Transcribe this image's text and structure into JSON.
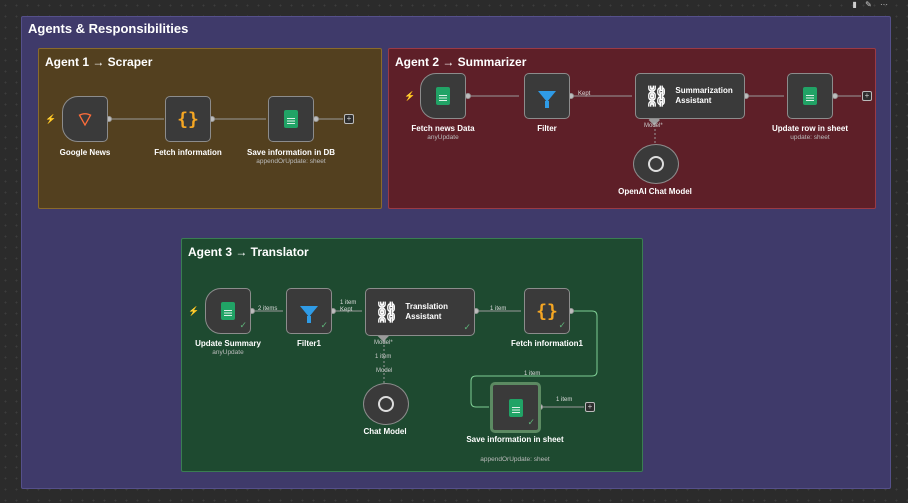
{
  "top_icons": [
    "trash-icon",
    "edit-icon",
    "more-icon"
  ],
  "outer": {
    "title": "Agents & Responsibilities"
  },
  "agent1": {
    "title": "Agent 1 → Scraper",
    "nodes": [
      {
        "label": "Google News",
        "icon": "rss-icon"
      },
      {
        "label": "Fetch information",
        "icon": "braces-icon"
      },
      {
        "label": "Save information in DB",
        "sub": "appendOrUpdate: sheet",
        "icon": "sheets-icon"
      }
    ]
  },
  "agent2": {
    "title": "Agent 2 → Summarizer",
    "nodes": [
      {
        "label": "Fetch news Data",
        "sub": "anyUpdate",
        "icon": "sheets-icon"
      },
      {
        "label": "Filter",
        "icon": "filter-icon"
      },
      {
        "label": "Summarization Assistant",
        "icon": "link-icon"
      },
      {
        "label": "Update row in sheet",
        "sub": "update: sheet",
        "icon": "sheets-icon"
      },
      {
        "label": "OpenAI Chat Model",
        "icon": "openai-icon"
      }
    ],
    "edge_kept": "Kept",
    "model_label": "Model*"
  },
  "agent3": {
    "title": "Agent 3 → Translator",
    "nodes": [
      {
        "label": "Update Summary",
        "sub": "anyUpdate",
        "icon": "sheets-icon"
      },
      {
        "label": "Filter1",
        "icon": "filter-icon"
      },
      {
        "label": "Translation Assistant",
        "icon": "link-icon"
      },
      {
        "label": "Fetch information1",
        "icon": "braces-icon"
      },
      {
        "label": "Save information in sheet",
        "sub": "appendOrUpdate: sheet",
        "icon": "sheets-icon"
      },
      {
        "label": "Chat Model",
        "icon": "openai-icon"
      }
    ],
    "edges": {
      "e1": "2 items",
      "e2_count": "1 item",
      "e2_kept": "Kept",
      "e3": "1 item",
      "e4": "1 item",
      "e5": "1 item",
      "model_star": "Model*",
      "model_count": "1 item",
      "model": "Model"
    }
  }
}
